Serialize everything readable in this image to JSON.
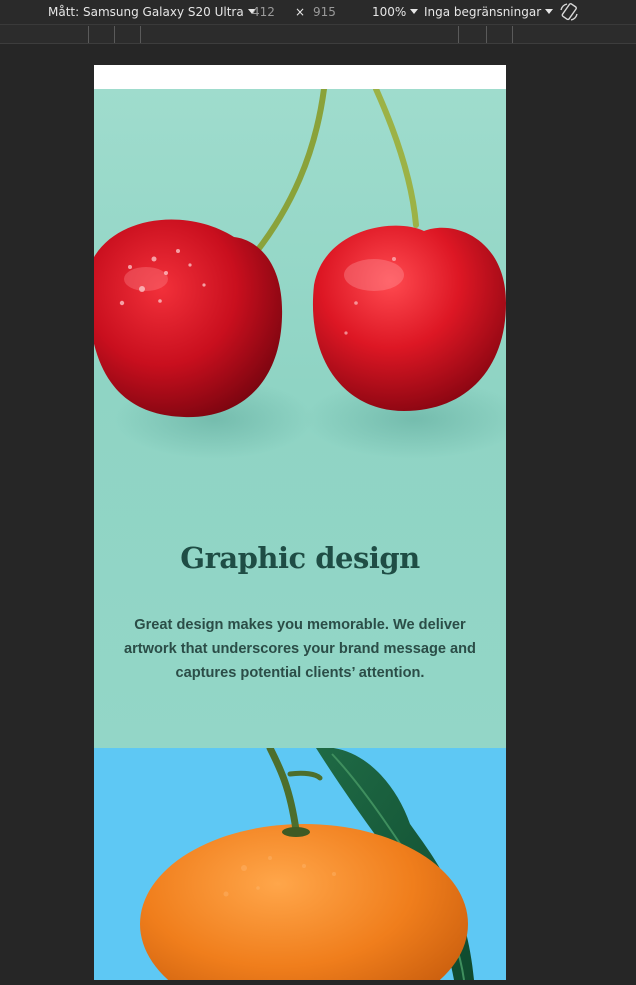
{
  "devtools": {
    "device_label": "Mått: Samsung Galaxy S20 Ultra",
    "width": "412",
    "times": "×",
    "height": "915",
    "zoom": "100%",
    "throttling": "Inga begränsningar",
    "rotate_icon": "rotate-icon"
  },
  "page": {
    "hero": {
      "title": "Graphic design",
      "text": "Great design makes you memorable. We deliver artwork that underscores your brand message and captures potential clients’ attention.",
      "image": "cherries-icon",
      "bg_color": "#95d8c8",
      "title_color": "#1f4d45"
    },
    "next_section": {
      "image": "orange-icon",
      "bg_color": "#5ec8f4"
    }
  }
}
